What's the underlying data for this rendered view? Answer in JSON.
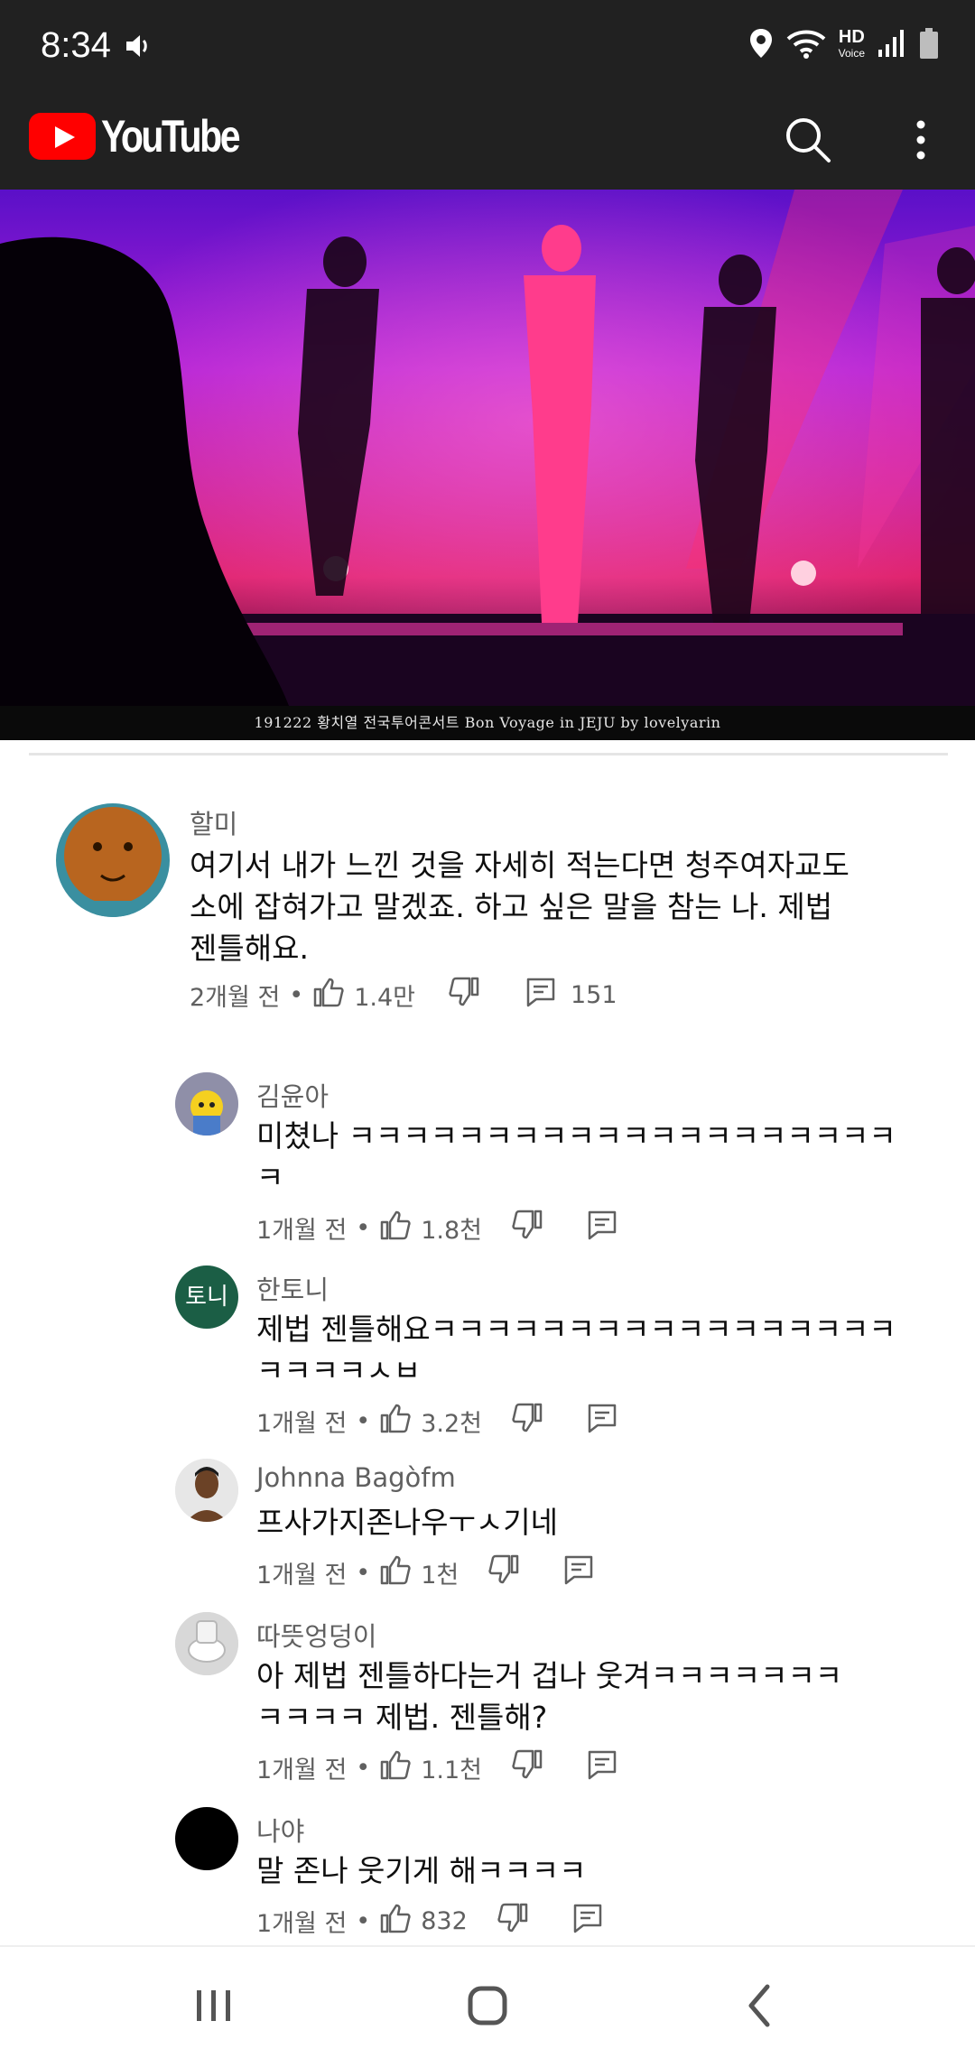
{
  "status_bar": {
    "time": "8:34",
    "hd_label": "HD",
    "voice_label": "Voice"
  },
  "app_bar": {
    "logo_text": "YouTube",
    "brand_color": "#ff0000",
    "icons": [
      "search-icon",
      "more-vert-icon"
    ]
  },
  "video": {
    "caption": "191222 황치열 전국투어콘서트 Bon Voyage in JEJU by lovelyarin"
  },
  "comments": [
    {
      "author": "할미",
      "text_lines": [
        "여기서 내가 느낀 것을 자세히 적는다면 청주여자교도",
        "소에 잡혀가고 말겠죠. 하고 싶은 말을 참는 나. 제법",
        "젠틀해요."
      ],
      "time": "2개월 전",
      "likes": "1.4만",
      "replies": "151"
    },
    {
      "author": "김윤아",
      "text_lines": [
        "미쳤나 ㅋㅋㅋㅋㅋㅋㅋㅋㅋㅋㅋㅋㅋㅋㅋㅋㅋㅋㅋㅋ",
        "ㅋ"
      ],
      "time": "1개월 전",
      "likes": "1.8천"
    },
    {
      "author": "한토니",
      "avatar_text": "토니",
      "text_lines": [
        "제법 젠틀해요ㅋㅋㅋㅋㅋㅋㅋㅋㅋㅋㅋㅋㅋㅋㅋㅋㅋ",
        "ㅋㅋㅋㅋㅅㅂ"
      ],
      "time": "1개월 전",
      "likes": "3.2천"
    },
    {
      "author": "Johnna Bagòfm",
      "text_lines": [
        "프사가지존나우ㅜㅅ기네"
      ],
      "time": "1개월 전",
      "likes": "1천"
    },
    {
      "author": "따뜻엉덩이",
      "text_lines": [
        "아 제법 젠틀하다는거 겁나 웃겨ㅋㅋㅋㅋㅋㅋㅋ",
        "ㅋㅋㅋㅋ 제법. 젠틀해?"
      ],
      "time": "1개월 전",
      "likes": "1.1천"
    },
    {
      "author": "나야",
      "text_lines": [
        "말 존나 웃기게 해ㅋㅋㅋㅋ"
      ],
      "time": "1개월 전",
      "likes": "832"
    }
  ],
  "meta_separator": "•",
  "nav_bar": {
    "buttons": [
      "recent-apps-icon",
      "home-icon",
      "back-icon"
    ]
  }
}
